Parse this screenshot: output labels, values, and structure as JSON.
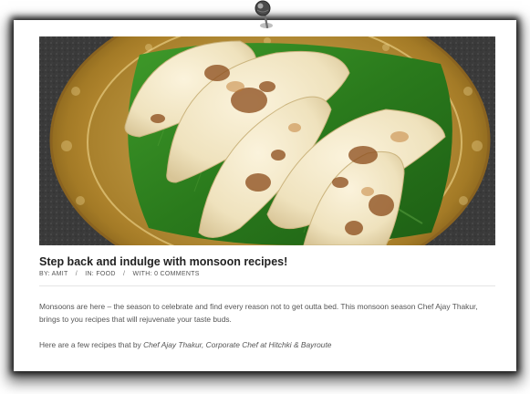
{
  "post": {
    "title": "Step back and indulge with monsoon recipes!",
    "meta": {
      "by_label": "BY:",
      "author": "AMIT",
      "in_label": "IN:",
      "category": "FOOD",
      "with_label": "WITH:",
      "comments": "0 COMMENTS",
      "separator": "/"
    },
    "paragraph_1": "Monsoons are here –  the season to celebrate and find every reason not  to get outta bed. This monsoon season Chef Ajay Thakur, brings to you recipes that will rejuvenate your taste buds.",
    "paragraph_2_prefix": "Here are a few recipes that by ",
    "paragraph_2_emphasis": "Chef Ajay Thakur, Corporate Chef at Hitchki & Bayroute"
  },
  "icons": {
    "pin": "push-pin-icon"
  },
  "colors": {
    "title": "#222222",
    "body_text": "#555555",
    "brass_plate": "#c9a248",
    "banana_leaf": "#2f7d1f"
  }
}
